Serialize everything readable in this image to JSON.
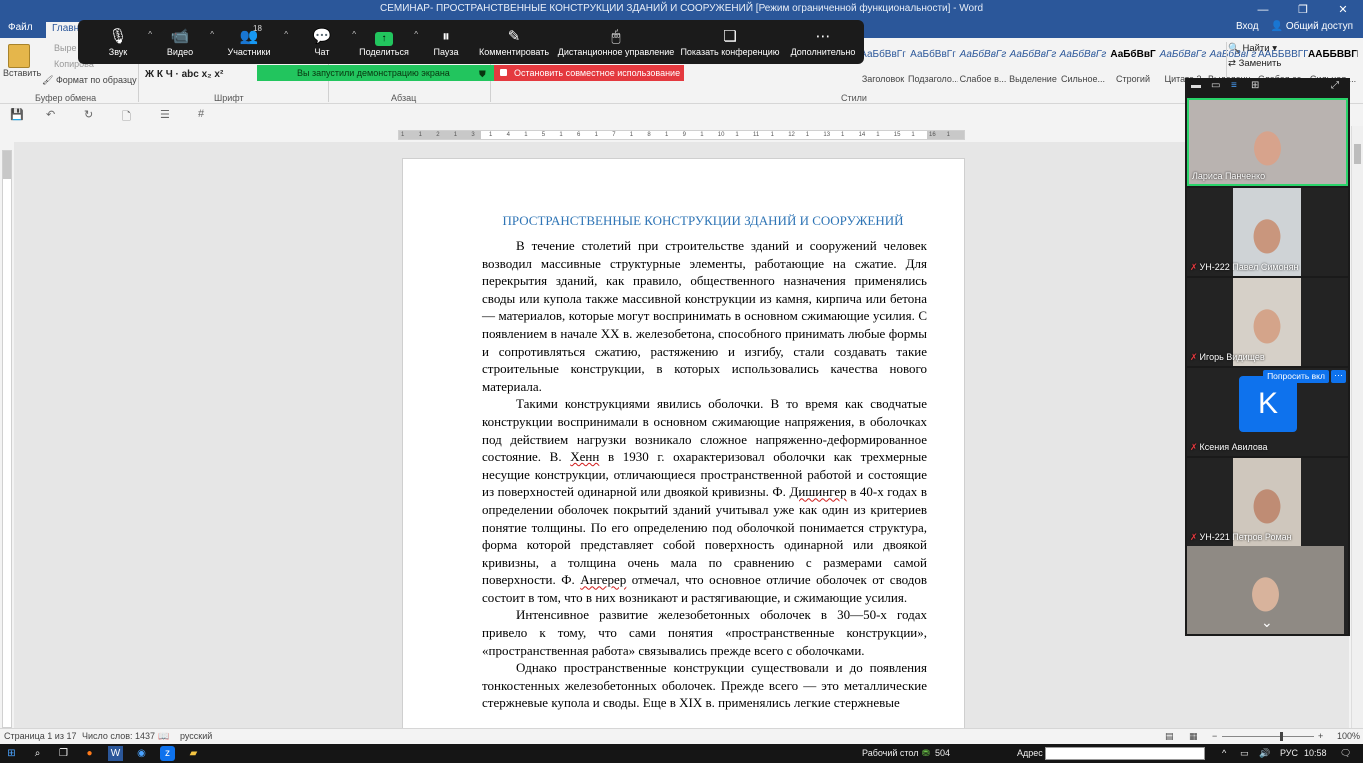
{
  "window": {
    "title": "СЕМИНАР- ПРОСТРАНСТВЕННЫЕ КОНСТРУКЦИИ ЗДАНИЙ И СООРУЖЕНИЙ [Режим ограниченной функциональности] - Word",
    "sign_in": "Вход",
    "share": "Общий доступ",
    "minimize": "—",
    "restore": "❐",
    "close": "✕"
  },
  "tabs": {
    "file": "Файл",
    "home": "Главна"
  },
  "ribbon": {
    "paste": "Вставить",
    "cut": "Выре",
    "copy": "Копирова",
    "format_painter": "Формат по образцу",
    "clipboard_group": "Буфер обмена",
    "font_group": "Шрифт",
    "paragraph_group": "Абзац",
    "styles_group": "Стили",
    "font_buttons": "Ж  К  Ч  ·  abc  x₂  x²",
    "find": "Найти",
    "replace": "Заменить",
    "styles": [
      {
        "sample": "АаБбВвГг",
        "name": "Заголовок",
        "variant": "normal"
      },
      {
        "sample": "АаБбВвГг",
        "name": "Подзаголо...",
        "variant": "normal"
      },
      {
        "sample": "АаБбВвГг",
        "name": "Слабое в...",
        "variant": "italic"
      },
      {
        "sample": "АаБбВвГг",
        "name": "Выделение",
        "variant": "italic"
      },
      {
        "sample": "АаБбВвГг",
        "name": "Сильное...",
        "variant": "italic"
      },
      {
        "sample": "АаБбВвГ",
        "name": "Строгий",
        "variant": "bold"
      },
      {
        "sample": "АаБбВвГг",
        "name": "Цитата 2",
        "variant": "italic"
      },
      {
        "sample": "АаБбВвГг",
        "name": "Выделенн...",
        "variant": "italic"
      },
      {
        "sample": "ААББВВГГ,",
        "name": "Слабая сс...",
        "variant": "normal"
      },
      {
        "sample": "ААББВВГГ,",
        "name": "Сильная ...",
        "variant": "bold"
      }
    ]
  },
  "zoom": {
    "audio": "Звук",
    "video": "Видео",
    "participants": "Участники",
    "participants_count": "18",
    "chat": "Чат",
    "share": "Поделиться",
    "pause": "Пауза",
    "annotate": "Комментировать",
    "remote_control": "Дистанционное управление",
    "show_conference": "Показать конференцию",
    "more": "Дополнительно",
    "sharing_banner": "Вы запустили демонстрацию экрана",
    "stop_share": "Остановить совместное использование",
    "ask_button": "Попросить вкл",
    "more_button": "···",
    "participant_tiles": [
      {
        "name": "Лариса Панченко",
        "muted": false,
        "video": true,
        "bg": "#b9b3b0",
        "skin": "#d7a38c"
      },
      {
        "name": "УН-222 Павел Симонян",
        "muted": true,
        "video": true,
        "bg": "#cfd3d6",
        "skin": "#c9967d"
      },
      {
        "name": "Игорь Видищев",
        "muted": true,
        "video": true,
        "bg": "#d6d0c8",
        "skin": "#d4a48a"
      },
      {
        "name": "Ксения Авилова",
        "muted": true,
        "video": false,
        "avatar": "K"
      },
      {
        "name": "УН-221 Петров Роман",
        "muted": true,
        "video": true,
        "bg": "#cfc7bd",
        "skin": "#bf8c74"
      },
      {
        "name": "",
        "muted": false,
        "video": true,
        "bg": "#8f8a84",
        "skin": "#d8b39c"
      }
    ]
  },
  "document": {
    "heading": "ПРОСТРАНСТВЕННЫЕ КОНСТРУКЦИИ ЗДАНИЙ И СООРУЖЕНИЙ",
    "p1": "В течение столетий при строительстве зданий и сооружений человек возводил массивные структурные элементы, работающие на сжатие. Для перекрытия зданий, как правило, общественного назначения применялись своды или купола также массивной конструкции из камня, кирпича или бетона — материалов, которые могут воспринимать в основном сжимающие усилия. С появлением в начале XX в. железобетона, способного принимать любые формы и сопротивляться сжатию, растяжению и изгибу, стали создавать такие строительные конструкции, в которых использовались качества нового материала.",
    "p2_a": "Такими конструкциями явились оболочки. В то время как сводчатые конструкции воспринимали в основном сжимающие напряжения, в оболочках под действием нагрузки возникало сложное напряженно-деформированное состояние. В. ",
    "p2_henn": "Хенн",
    "p2_b": " в 1930 г. охарактеризовал оболочки как трехмерные несущие конструкции, отличающиеся пространственной работой и состоящие из поверхностей одинарной или двоякой кривизны. Ф. ",
    "p2_dish": "Дишингер",
    "p2_c": " в 40-х годах в определении оболочек покрытий зданий учитывал уже как один из критериев понятие толщины. По его определению под оболочкой понимается структура, форма которой представляет собой поверхность одинарной или двоякой кривизны, а толщина очень мала по сравнению с размерами самой поверхности. Ф. ",
    "p2_anger": "Ангерер",
    "p2_d": " отмечал, что основное отличие оболочек от сводов состоит в том, что в них возникают и растягивающие, и сжимающие усилия.",
    "p3": "Интенсивное развитие железобетонных оболочек в 30—50-х годах привело к тому, что сами понятия «пространственные конструкции», «пространственная работа» связывались прежде всего с оболочками.",
    "p4": "Однако пространственные конструкции существовали и до появления тонкостенных железобетонных оболочек. Прежде всего — это металлические стержневые купола и своды. Еще в XIX в. применялись легкие стержневые"
  },
  "ruler": {
    "labels": [
      "1",
      "1",
      "2",
      "1",
      "3",
      "1",
      "4",
      "1",
      "5",
      "1",
      "6",
      "1",
      "7",
      "1",
      "8",
      "1",
      "9",
      "1",
      "10",
      "1",
      "11",
      "1",
      "12",
      "1",
      "13",
      "1",
      "14",
      "1",
      "15",
      "1",
      "16",
      "1",
      "17"
    ]
  },
  "statusbar": {
    "page": "Страница 1 из 17",
    "words": "Число слов: 1437",
    "language": "русский",
    "zoom": "100%",
    "minus": "−",
    "plus": "+"
  },
  "taskbar": {
    "desktop": "Рабочий стол",
    "count": "504",
    "address": "Адрес",
    "lang": "РУС",
    "time": "10:58"
  },
  "colors": {
    "word_blue": "#2b579a",
    "heading_blue": "#2e74b5",
    "zoom_green": "#22c55e",
    "zoom_red": "#e4393f",
    "zoom_blue": "#0e72ed"
  }
}
